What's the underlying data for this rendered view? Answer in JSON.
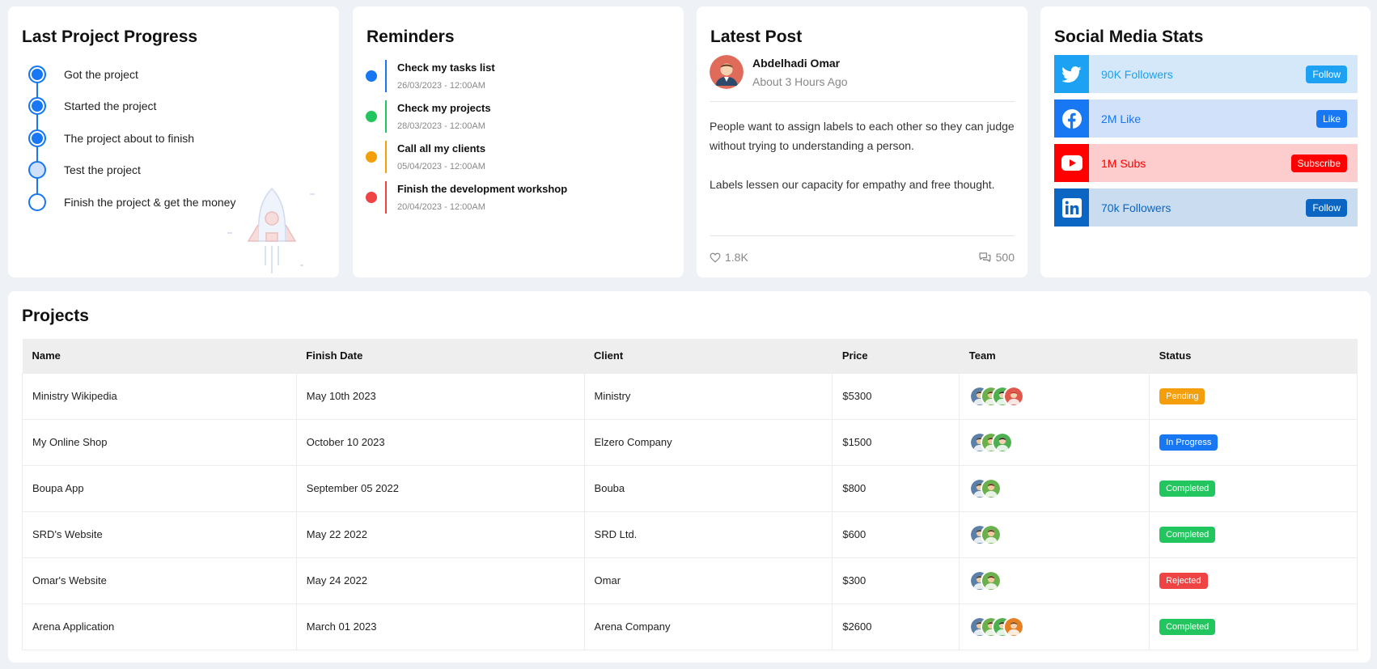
{
  "progress": {
    "title": "Last Project Progress",
    "steps": [
      {
        "label": "Got the project",
        "state": "done"
      },
      {
        "label": "Started the project",
        "state": "done"
      },
      {
        "label": "The project about to finish",
        "state": "done"
      },
      {
        "label": "Test the project",
        "state": "current"
      },
      {
        "label": "Finish the project & get the money",
        "state": "todo"
      }
    ]
  },
  "reminders": {
    "title": "Reminders",
    "items": [
      {
        "title": "Check my tasks list",
        "date": "26/03/2023 - 12:00AM",
        "color": "#1877f2"
      },
      {
        "title": "Check my projects",
        "date": "28/03/2023 - 12:00AM",
        "color": "#22c55e"
      },
      {
        "title": "Call all my clients",
        "date": "05/04/2023 - 12:00AM",
        "color": "#f59e0b"
      },
      {
        "title": "Finish the development workshop",
        "date": "20/04/2023 - 12:00AM",
        "color": "#ef4444"
      }
    ]
  },
  "post": {
    "title": "Latest Post",
    "author": "Abdelhadi Omar",
    "time": "About 3 Hours Ago",
    "paragraph1": "People want to assign labels to each other so they can judge without trying to understanding a person.",
    "paragraph2": "Labels lessen our capacity for empathy and free thought.",
    "likes": "1.8K",
    "comments": "500"
  },
  "social": {
    "title": "Social Media Stats",
    "items": [
      {
        "icon": "twitter-icon",
        "text": "90K Followers",
        "button": "Follow",
        "bg": "#d4e8f9",
        "iconbg": "#1da1f2",
        "textcolor": "#1da1f2",
        "btncolor": "#1da1f2"
      },
      {
        "icon": "facebook-icon",
        "text": "2M Like",
        "button": "Like",
        "bg": "#d0e1f9",
        "iconbg": "#1877f2",
        "textcolor": "#1877f2",
        "btncolor": "#1877f2"
      },
      {
        "icon": "youtube-icon",
        "text": "1M Subs",
        "button": "Subscribe",
        "bg": "#fdcdcd",
        "iconbg": "#ff0000",
        "textcolor": "#ff0000",
        "btncolor": "#ff0000"
      },
      {
        "icon": "linkedin-icon",
        "text": "70k Followers",
        "button": "Follow",
        "bg": "#cadcf0",
        "iconbg": "#0a66c2",
        "textcolor": "#0a66c2",
        "btncolor": "#0a66c2"
      }
    ]
  },
  "projects": {
    "title": "Projects",
    "headers": [
      "Name",
      "Finish Date",
      "Client",
      "Price",
      "Team",
      "Status"
    ],
    "rows": [
      {
        "name": "Ministry Wikipedia",
        "date": "May 10th 2023",
        "client": "Ministry",
        "price": "$5300",
        "team": 4,
        "status": "Pending",
        "status_color": "#f59e0b"
      },
      {
        "name": "My Online Shop",
        "date": "October 10 2023",
        "client": "Elzero Company",
        "price": "$1500",
        "team": 3,
        "status": "In Progress",
        "status_color": "#1877f2"
      },
      {
        "name": "Boupa App",
        "date": "September 05 2022",
        "client": "Bouba",
        "price": "$800",
        "team": 2,
        "status": "Completed",
        "status_color": "#22c55e"
      },
      {
        "name": "SRD's Website",
        "date": "May 22 2022",
        "client": "SRD Ltd.",
        "price": "$600",
        "team": 2,
        "status": "Completed",
        "status_color": "#22c55e"
      },
      {
        "name": "Omar's Website",
        "date": "May 24 2022",
        "client": "Omar",
        "price": "$300",
        "team": 2,
        "status": "Rejected",
        "status_color": "#ef4444"
      },
      {
        "name": "Arena Application",
        "date": "March 01 2023",
        "client": "Arena Company",
        "price": "$2600",
        "team": 4,
        "status": "Completed",
        "status_color": "#22c55e"
      }
    ]
  }
}
